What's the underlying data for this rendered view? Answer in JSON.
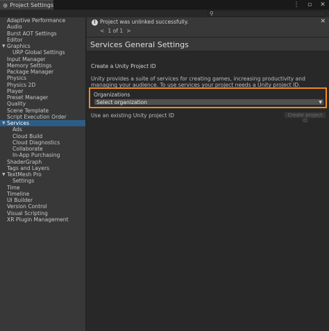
{
  "window": {
    "tab_title": "Project Settings",
    "icons": [
      "gear-icon",
      "kebab-menu-icon",
      "maximize-icon",
      "close-icon"
    ]
  },
  "toolbar": {
    "search_placeholder": ""
  },
  "sidebar": {
    "items": [
      {
        "label": "Adaptive Performance",
        "level": 0
      },
      {
        "label": "Audio",
        "level": 0
      },
      {
        "label": "Burst AOT Settings",
        "level": 0
      },
      {
        "label": "Editor",
        "level": 0
      },
      {
        "label": "Graphics",
        "level": 0,
        "expanded": true
      },
      {
        "label": "URP Global Settings",
        "level": 1
      },
      {
        "label": "Input Manager",
        "level": 0
      },
      {
        "label": "Memory Settings",
        "level": 0
      },
      {
        "label": "Package Manager",
        "level": 0
      },
      {
        "label": "Physics",
        "level": 0
      },
      {
        "label": "Physics 2D",
        "level": 0
      },
      {
        "label": "Player",
        "level": 0
      },
      {
        "label": "Preset Manager",
        "level": 0
      },
      {
        "label": "Quality",
        "level": 0
      },
      {
        "label": "Scene Template",
        "level": 0
      },
      {
        "label": "Script Execution Order",
        "level": 0
      },
      {
        "label": "Services",
        "level": 0,
        "expanded": true,
        "selected": true
      },
      {
        "label": "Ads",
        "level": 1
      },
      {
        "label": "Cloud Build",
        "level": 1
      },
      {
        "label": "Cloud Diagnostics",
        "level": 1
      },
      {
        "label": "Collaborate",
        "level": 1
      },
      {
        "label": "In-App Purchasing",
        "level": 1
      },
      {
        "label": "ShaderGraph",
        "level": 0
      },
      {
        "label": "Tags and Layers",
        "level": 0
      },
      {
        "label": "TextMesh Pro",
        "level": 0,
        "expanded": true
      },
      {
        "label": "Settings",
        "level": 1
      },
      {
        "label": "Time",
        "level": 0
      },
      {
        "label": "Timeline",
        "level": 0
      },
      {
        "label": "UI Builder",
        "level": 0
      },
      {
        "label": "Version Control",
        "level": 0
      },
      {
        "label": "Visual Scripting",
        "level": 0
      },
      {
        "label": "XR Plugin Management",
        "level": 0
      }
    ]
  },
  "notification": {
    "message": "Project was unlinked successfully.",
    "pager_prev": "<",
    "pager_text": "1 of 1",
    "pager_next": ">"
  },
  "main": {
    "section_title": "Services General Settings",
    "create_heading": "Create a Unity Project ID",
    "description": "Unity provides a suite of services for creating games, increasing productivity and managing your audience. To use services your project needs a Unity project ID.",
    "organizations_label": "Organizations",
    "organizations_value": "Select organization",
    "existing_label": "Use an existing Unity project ID",
    "create_button_label": "Create project ID"
  },
  "colors": {
    "highlight_border": "#f28a1e",
    "selected_item": "#2c5d87"
  }
}
